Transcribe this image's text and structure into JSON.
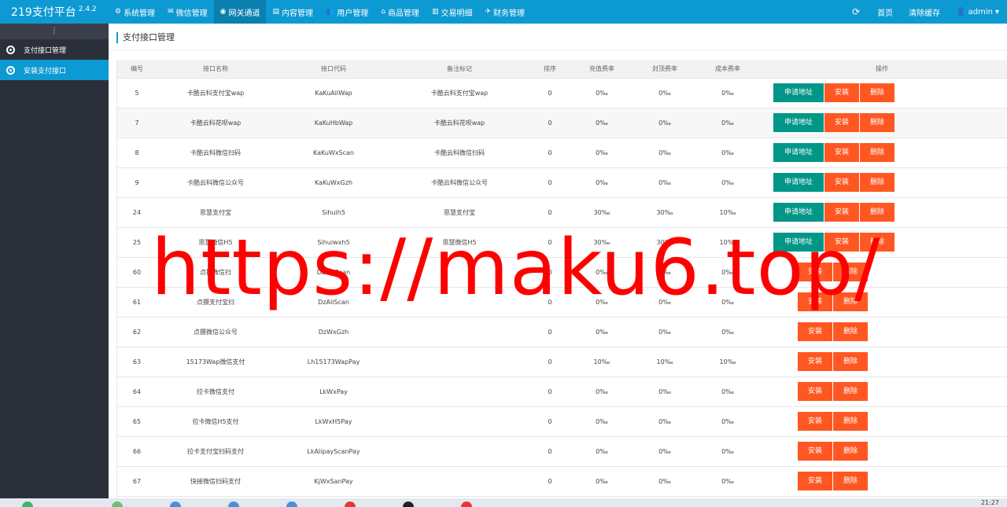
{
  "app": {
    "title": "219支付平台",
    "version": "2.4.2"
  },
  "nav": [
    {
      "label": "系统管理",
      "icon": "gear-icon",
      "glyph": "⚙"
    },
    {
      "label": "微信管理",
      "icon": "wechat-icon",
      "glyph": "✉"
    },
    {
      "label": "网关通道",
      "icon": "gateway-icon",
      "glyph": "◉"
    },
    {
      "label": "内容管理",
      "icon": "document-icon",
      "glyph": "▤"
    },
    {
      "label": "用户管理",
      "icon": "users-icon",
      "glyph": "👥"
    },
    {
      "label": "商品管理",
      "icon": "shop-icon",
      "glyph": "⌂"
    },
    {
      "label": "交易明细",
      "icon": "bar-chart-icon",
      "glyph": "▥"
    },
    {
      "label": "财务管理",
      "icon": "finance-icon",
      "glyph": "✈"
    }
  ],
  "nav_active": "网关通道",
  "top_right": {
    "refresh_glyph": "⟳",
    "home": "首页",
    "clear_cache": "清除缓存",
    "user": "admin",
    "user_glyph": "👤",
    "caret": "▾"
  },
  "sidebar": {
    "toggle_glyph": "⋮",
    "items": [
      {
        "label": "支付接口管理"
      },
      {
        "label": "安装支付接口"
      }
    ]
  },
  "page_title": "支付接口管理",
  "table": {
    "headers": [
      "编号",
      "接口名称",
      "接口代码",
      "备注标记",
      "排序",
      "充值费率",
      "封顶费率",
      "成本费率",
      "操作"
    ],
    "rows": [
      {
        "id": "5",
        "name": "卡酷云科支付宝wap",
        "code": "KaKuAliWap",
        "remark": "卡酷云科支付宝wap",
        "sort": "0",
        "rate": "0‰",
        "cap": "0‰",
        "cost": "0‰",
        "apply": true
      },
      {
        "id": "7",
        "name": "卡酷云科花呗wap",
        "code": "KaKuHbWap",
        "remark": "卡酷云科花呗wap",
        "sort": "0",
        "rate": "0‰",
        "cap": "0‰",
        "cost": "0‰",
        "apply": true
      },
      {
        "id": "8",
        "name": "卡酷云科微信扫码",
        "code": "KaKuWxScan",
        "remark": "卡酷云科微信扫码",
        "sort": "0",
        "rate": "0‰",
        "cap": "0‰",
        "cost": "0‰",
        "apply": true
      },
      {
        "id": "9",
        "name": "卡酷云科微信公众号",
        "code": "KaKuWxGzh",
        "remark": "卡酷云科微信公众号",
        "sort": "0",
        "rate": "0‰",
        "cap": "0‰",
        "cost": "0‰",
        "apply": true
      },
      {
        "id": "24",
        "name": "思慧支付宝",
        "code": "Sihuih5",
        "remark": "思慧支付宝",
        "sort": "0",
        "rate": "30‰",
        "cap": "30‰",
        "cost": "10‰",
        "apply": true
      },
      {
        "id": "25",
        "name": "思慧微信H5",
        "code": "Sihuiwxh5",
        "remark": "思慧微信H5",
        "sort": "0",
        "rate": "30‰",
        "cap": "30‰",
        "cost": "10‰",
        "apply": true
      },
      {
        "id": "60",
        "name": "点摄微信扫",
        "code": "DzWxScan",
        "remark": "",
        "sort": "0",
        "rate": "0‰",
        "cap": "0‰",
        "cost": "0‰",
        "apply": false
      },
      {
        "id": "61",
        "name": "点摄支付宝扫",
        "code": "DzAliScan",
        "remark": "",
        "sort": "0",
        "rate": "0‰",
        "cap": "0‰",
        "cost": "0‰",
        "apply": false
      },
      {
        "id": "62",
        "name": "点摄微信公众号",
        "code": "DzWxGzh",
        "remark": "",
        "sort": "0",
        "rate": "0‰",
        "cap": "0‰",
        "cost": "0‰",
        "apply": false
      },
      {
        "id": "63",
        "name": "15173Wap微信支付",
        "code": "Lh15173WapPay",
        "remark": "",
        "sort": "0",
        "rate": "10‰",
        "cap": "10‰",
        "cost": "10‰",
        "apply": false
      },
      {
        "id": "64",
        "name": "拉卡微信支付",
        "code": "LkWxPay",
        "remark": "",
        "sort": "0",
        "rate": "0‰",
        "cap": "0‰",
        "cost": "0‰",
        "apply": false
      },
      {
        "id": "65",
        "name": "拉卡微信H5支付",
        "code": "LkWxH5Pay",
        "remark": "",
        "sort": "0",
        "rate": "0‰",
        "cap": "0‰",
        "cost": "0‰",
        "apply": false
      },
      {
        "id": "66",
        "name": "拉卡支付宝扫码支付",
        "code": "LkAlipayScanPay",
        "remark": "",
        "sort": "0",
        "rate": "0‰",
        "cap": "0‰",
        "cost": "0‰",
        "apply": false
      },
      {
        "id": "67",
        "name": "快接微信扫码支付",
        "code": "KjWxSanPay",
        "remark": "",
        "sort": "0",
        "rate": "0‰",
        "cap": "0‰",
        "cost": "0‰",
        "apply": false
      },
      {
        "id": "",
        "name": "",
        "code": "",
        "remark": "",
        "sort": "",
        "rate": "",
        "cap": "",
        "cost": "",
        "apply": false
      }
    ],
    "btn_apply": "申请地址",
    "btn_install": "安装",
    "btn_delete": "删除"
  },
  "watermark": "https://maku6.top/",
  "taskbar": {
    "clock": "21:27"
  },
  "colors": {
    "primary": "#0d99d2",
    "sidebar": "#2b2f3a",
    "apply": "#009688",
    "danger": "#ff5722",
    "watermark": "#ff0000"
  }
}
